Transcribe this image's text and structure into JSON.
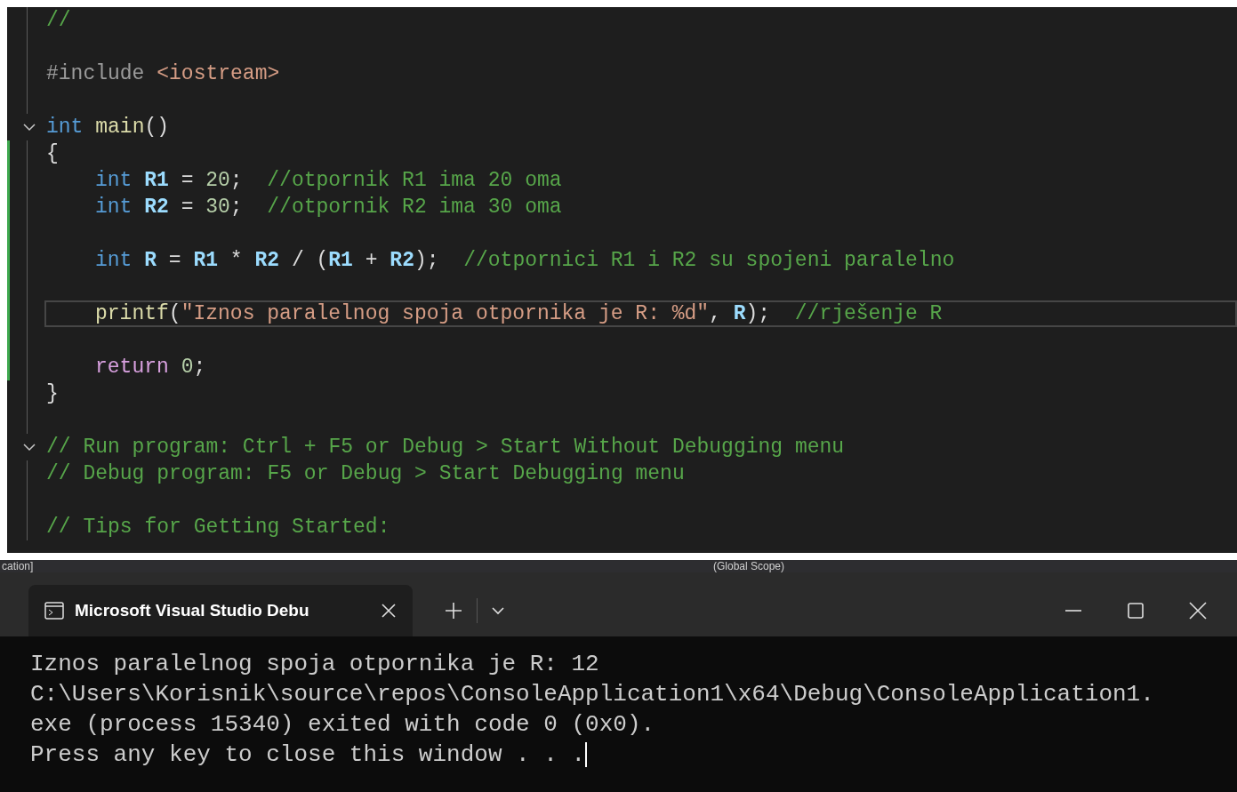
{
  "editor": {
    "lines": [
      {
        "kind": "code",
        "fold": false,
        "changed": false,
        "current": false,
        "tokens": [
          {
            "kind": "comment",
            "text": "//"
          }
        ]
      },
      {
        "kind": "blank",
        "fold": false,
        "changed": false,
        "current": false
      },
      {
        "kind": "code",
        "fold": false,
        "changed": false,
        "current": false,
        "tokens": [
          {
            "kind": "preproc",
            "text": "#include "
          },
          {
            "kind": "string",
            "text": "<iostream>"
          }
        ]
      },
      {
        "kind": "blank",
        "fold": false,
        "changed": false,
        "current": false
      },
      {
        "kind": "code",
        "fold": true,
        "changed": false,
        "current": false,
        "tokens": [
          {
            "kind": "keyword",
            "text": "int "
          },
          {
            "kind": "function",
            "text": "main"
          },
          {
            "kind": "plain",
            "text": "()"
          }
        ]
      },
      {
        "kind": "code",
        "fold": false,
        "changed": true,
        "current": false,
        "tokens": [
          {
            "kind": "plain",
            "text": "{"
          }
        ]
      },
      {
        "kind": "code",
        "fold": false,
        "changed": true,
        "current": false,
        "indent": true,
        "tokens": [
          {
            "kind": "keyword",
            "text": "int "
          },
          {
            "kind": "variable",
            "text": "R1"
          },
          {
            "kind": "plain",
            "text": " = "
          },
          {
            "kind": "number",
            "text": "20"
          },
          {
            "kind": "plain",
            "text": ";  "
          },
          {
            "kind": "comment",
            "text": "//otpornik R1 ima 20 oma"
          }
        ]
      },
      {
        "kind": "code",
        "fold": false,
        "changed": true,
        "current": false,
        "indent": true,
        "tokens": [
          {
            "kind": "keyword",
            "text": "int "
          },
          {
            "kind": "variable",
            "text": "R2"
          },
          {
            "kind": "plain",
            "text": " = "
          },
          {
            "kind": "number",
            "text": "30"
          },
          {
            "kind": "plain",
            "text": ";  "
          },
          {
            "kind": "comment",
            "text": "//otpornik R2 ima 30 oma"
          }
        ]
      },
      {
        "kind": "blank",
        "fold": false,
        "changed": true,
        "current": false
      },
      {
        "kind": "code",
        "fold": false,
        "changed": true,
        "current": false,
        "indent": true,
        "tokens": [
          {
            "kind": "keyword",
            "text": "int "
          },
          {
            "kind": "variable",
            "text": "R"
          },
          {
            "kind": "plain",
            "text": " = "
          },
          {
            "kind": "variable",
            "text": "R1"
          },
          {
            "kind": "plain",
            "text": " * "
          },
          {
            "kind": "variable",
            "text": "R2"
          },
          {
            "kind": "plain",
            "text": " / ("
          },
          {
            "kind": "variable",
            "text": "R1"
          },
          {
            "kind": "plain",
            "text": " + "
          },
          {
            "kind": "variable",
            "text": "R2"
          },
          {
            "kind": "plain",
            "text": ");  "
          },
          {
            "kind": "comment",
            "text": "//otpornici R1 i R2 su spojeni paralelno"
          }
        ]
      },
      {
        "kind": "blank",
        "fold": false,
        "changed": true,
        "current": false
      },
      {
        "kind": "code",
        "fold": false,
        "changed": true,
        "current": true,
        "indent": true,
        "tokens": [
          {
            "kind": "function",
            "text": "printf"
          },
          {
            "kind": "plain",
            "text": "("
          },
          {
            "kind": "string",
            "text": "\"Iznos paralelnog spoja otpornika je R: %d\""
          },
          {
            "kind": "plain",
            "text": ", "
          },
          {
            "kind": "variable",
            "text": "R"
          },
          {
            "kind": "plain",
            "text": ");  "
          },
          {
            "kind": "comment",
            "text": "//rješenje R"
          }
        ]
      },
      {
        "kind": "blank",
        "fold": false,
        "changed": true,
        "current": false
      },
      {
        "kind": "code",
        "fold": false,
        "changed": true,
        "current": false,
        "indent": true,
        "tokens": [
          {
            "kind": "control",
            "text": "return "
          },
          {
            "kind": "number",
            "text": "0"
          },
          {
            "kind": "plain",
            "text": ";"
          }
        ]
      },
      {
        "kind": "code",
        "fold": false,
        "changed": false,
        "current": false,
        "tokens": [
          {
            "kind": "plain",
            "text": "}"
          }
        ]
      },
      {
        "kind": "blank",
        "fold": false,
        "changed": false,
        "current": false
      },
      {
        "kind": "code",
        "fold": true,
        "changed": false,
        "current": false,
        "tokens": [
          {
            "kind": "comment",
            "text": "// Run program: Ctrl + F5 or Debug > Start Without Debugging menu"
          }
        ]
      },
      {
        "kind": "code",
        "fold": false,
        "changed": false,
        "current": false,
        "tokens": [
          {
            "kind": "comment",
            "text": "// Debug program: F5 or Debug > Start Debugging menu"
          }
        ]
      },
      {
        "kind": "blank",
        "fold": false,
        "changed": false,
        "current": false
      },
      {
        "kind": "code",
        "fold": false,
        "changed": false,
        "current": false,
        "tokens": [
          {
            "kind": "comment",
            "text": "// Tips for Getting Started:"
          }
        ]
      }
    ]
  },
  "ide_toolbar": {
    "project": "cation]",
    "scope": "(Global Scope)"
  },
  "terminal": {
    "tab": {
      "title": "Microsoft Visual Studio Debu",
      "selected": true
    },
    "output": [
      "Iznos paralelnog spoja otpornika je R: 12",
      "C:\\Users\\Korisnik\\source\\repos\\ConsoleApplication1\\x64\\Debug\\ConsoleApplication1.",
      "exe (process 15340) exited with code 0 (0x0).",
      "Press any key to close this window . . ."
    ]
  }
}
